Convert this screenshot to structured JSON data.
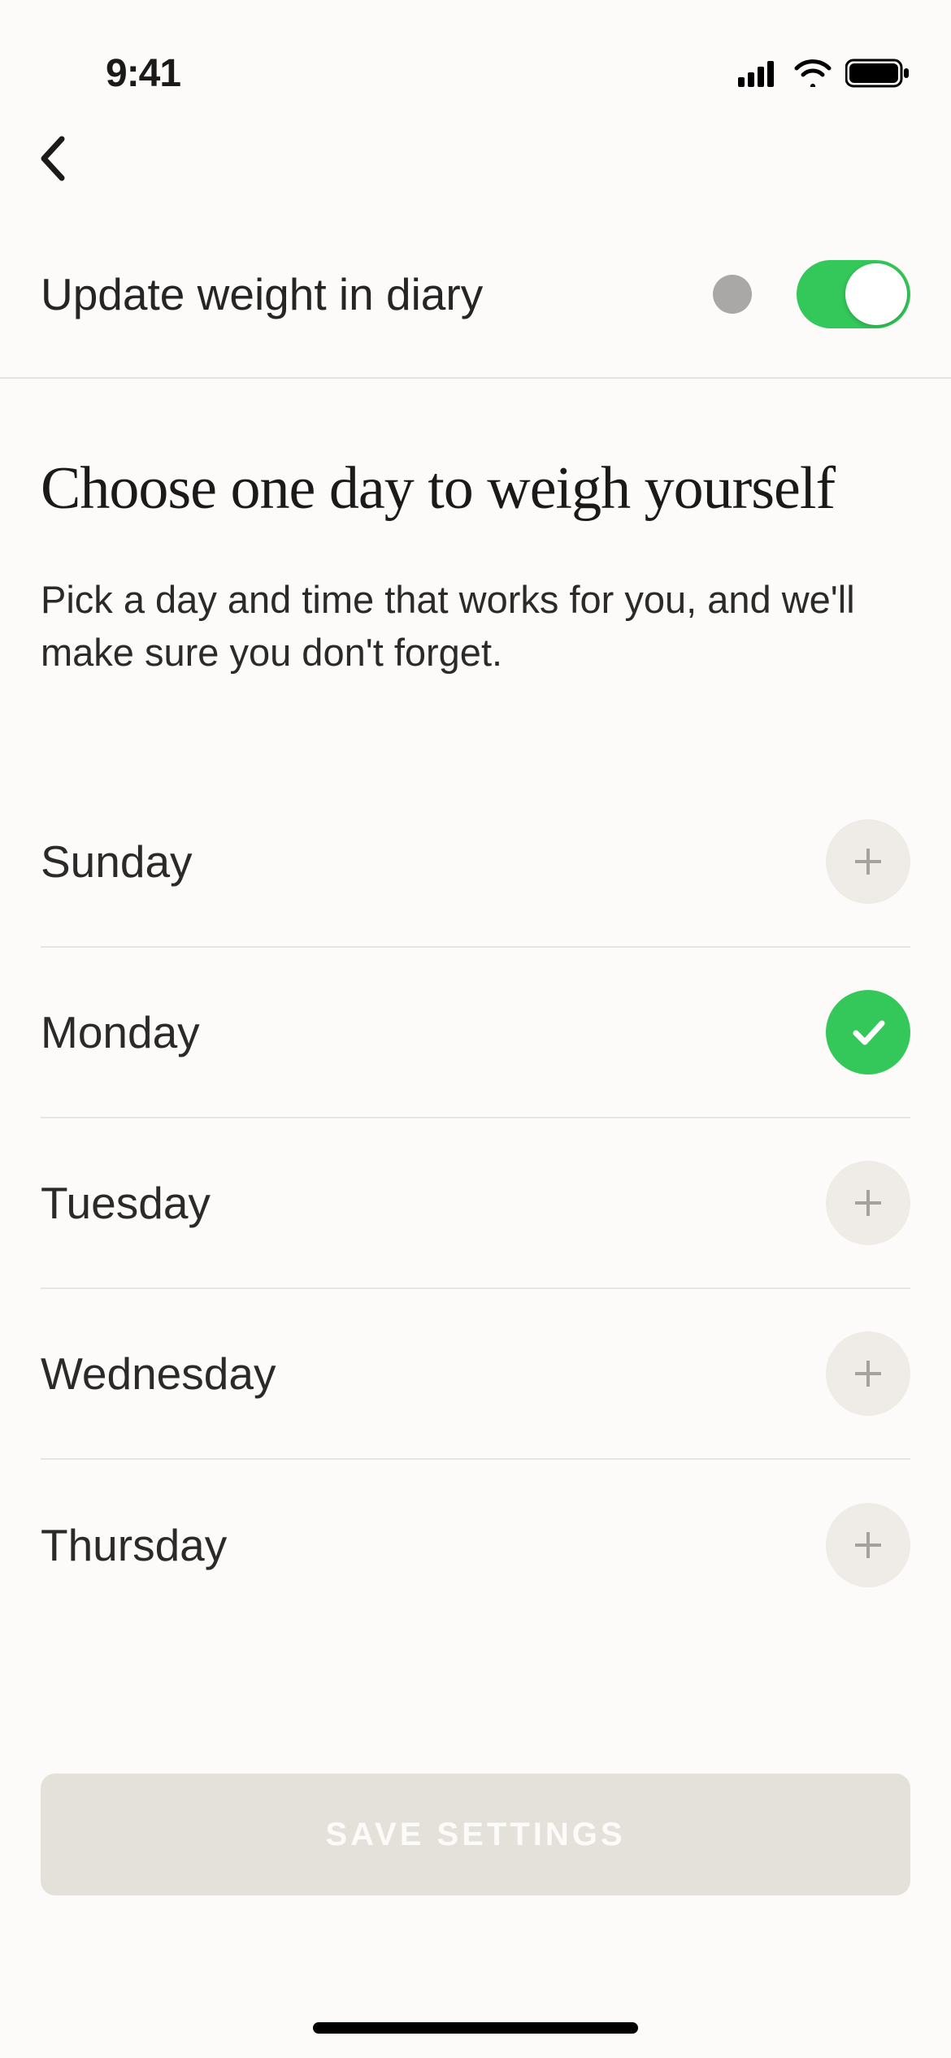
{
  "status": {
    "time": "9:41"
  },
  "toggle": {
    "label": "Update weight in diary",
    "on": true
  },
  "heading": {
    "title": "Choose one day to weigh yourself",
    "subtitle": "Pick a day and time that works for you, and we'll make sure you don't forget."
  },
  "days": [
    {
      "label": "Sunday",
      "selected": false
    },
    {
      "label": "Monday",
      "selected": true
    },
    {
      "label": "Tuesday",
      "selected": false
    },
    {
      "label": "Wednesday",
      "selected": false
    },
    {
      "label": "Thursday",
      "selected": false
    }
  ],
  "save_button_label": "SAVE SETTINGS"
}
